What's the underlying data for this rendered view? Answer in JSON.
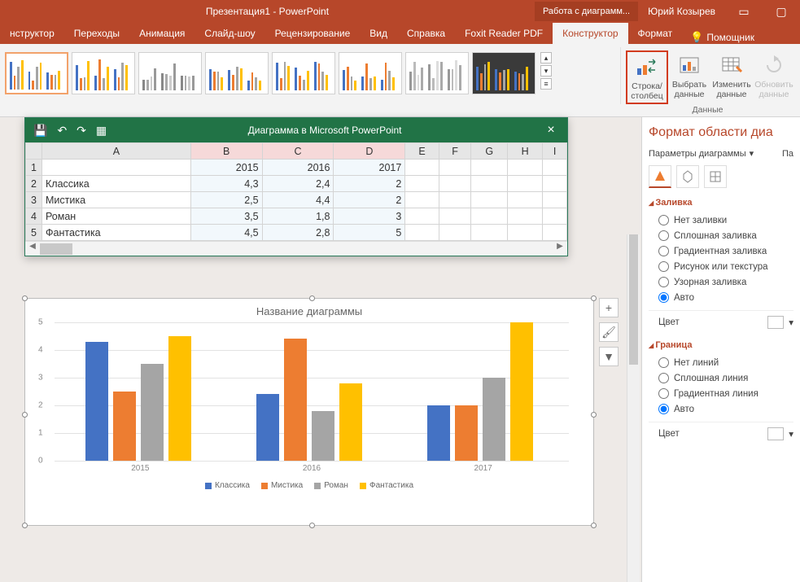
{
  "titlebar": {
    "title": "Презентация1 - PowerPoint",
    "context": "Работа с диаграмм...",
    "user": "Юрий Козырев"
  },
  "tabs": {
    "items": [
      "нструктор",
      "Переходы",
      "Анимация",
      "Слайд-шоу",
      "Рецензирование",
      "Вид",
      "Справка",
      "Foxit Reader PDF",
      "Конструктор",
      "Формат"
    ],
    "active_index": 8,
    "help": "Помощник"
  },
  "ribbon": {
    "data_group_label": "Данные",
    "buttons": {
      "switch": "Строка/\nстолбец",
      "select": "Выбрать\nданные",
      "edit": "Изменить\nданные",
      "refresh": "Обновить\nданные"
    }
  },
  "sheet": {
    "title": "Диаграмма в Microsoft PowerPoint",
    "cols": [
      "A",
      "B",
      "C",
      "D",
      "E",
      "F",
      "G",
      "H",
      "I"
    ],
    "rows": [
      {
        "n": "1",
        "cells": [
          "",
          "2015",
          "2016",
          "2017",
          "",
          "",
          "",
          "",
          ""
        ]
      },
      {
        "n": "2",
        "cells": [
          "Классика",
          "4,3",
          "2,4",
          "2",
          "",
          "",
          "",
          "",
          ""
        ]
      },
      {
        "n": "3",
        "cells": [
          "Мистика",
          "2,5",
          "4,4",
          "2",
          "",
          "",
          "",
          "",
          ""
        ]
      },
      {
        "n": "4",
        "cells": [
          "Роман",
          "3,5",
          "1,8",
          "3",
          "",
          "",
          "",
          "",
          ""
        ]
      },
      {
        "n": "5",
        "cells": [
          "Фантастика",
          "4,5",
          "2,8",
          "5",
          "",
          "",
          "",
          "",
          ""
        ]
      }
    ]
  },
  "chart": {
    "title": "Название диаграммы"
  },
  "chart_data": {
    "type": "bar",
    "categories": [
      "2015",
      "2016",
      "2017"
    ],
    "series": [
      {
        "name": "Классика",
        "color": "#4472c4",
        "values": [
          4.3,
          2.4,
          2
        ]
      },
      {
        "name": "Мистика",
        "color": "#ed7d31",
        "values": [
          2.5,
          4.4,
          2
        ]
      },
      {
        "name": "Роман",
        "color": "#a5a5a5",
        "values": [
          3.5,
          1.8,
          3
        ]
      },
      {
        "name": "Фантастика",
        "color": "#ffc000",
        "values": [
          4.5,
          2.8,
          5
        ]
      }
    ],
    "ylim": [
      0,
      5
    ],
    "yticks": [
      0,
      1,
      2,
      3,
      4,
      5
    ]
  },
  "pane": {
    "title": "Формат области диа",
    "subtitle": "Параметры диаграммы",
    "extra": "Па",
    "fill_section": "Заливка",
    "fill_options": [
      "Нет заливки",
      "Сплошная заливка",
      "Градиентная заливка",
      "Рисунок или текстура",
      "Узорная заливка",
      "Авто"
    ],
    "fill_selected": 5,
    "color_label": "Цвет",
    "border_section": "Граница",
    "border_options": [
      "Нет линий",
      "Сплошная линия",
      "Градиентная линия",
      "Авто"
    ],
    "border_selected": 3
  }
}
